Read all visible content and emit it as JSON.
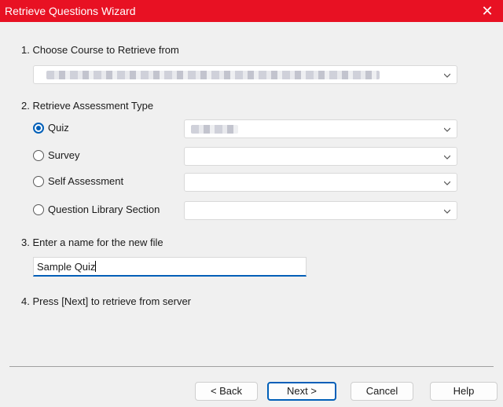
{
  "window": {
    "title": "Retrieve Questions Wizard"
  },
  "steps": {
    "step1": "1.  Choose Course to Retrieve from",
    "step2": "2.  Retrieve Assessment Type",
    "step3": "3.  Enter a name for the new file",
    "step4": "4.  Press [Next] to retrieve from server"
  },
  "assessment_types": [
    {
      "label": "Quiz",
      "selected": true
    },
    {
      "label": "Survey",
      "selected": false
    },
    {
      "label": "Self Assessment",
      "selected": false
    },
    {
      "label": "Question Library Section",
      "selected": false
    }
  ],
  "filename": {
    "value": "Sample Quiz"
  },
  "buttons": {
    "back": "< Back",
    "next": "Next >",
    "cancel": "Cancel",
    "help": "Help"
  },
  "colors": {
    "titlebar": "#e81123",
    "accent": "#005fb8"
  },
  "icons": {
    "close": "close-icon",
    "dropdown": "chevron-down-icon"
  }
}
